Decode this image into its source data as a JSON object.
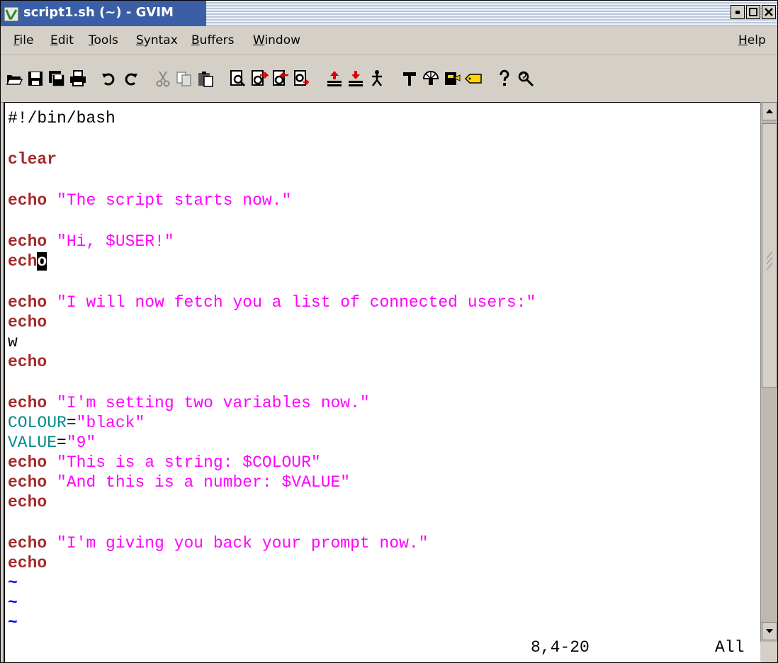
{
  "window": {
    "title": "script1.sh (~) - GVIM"
  },
  "menubar": {
    "items": [
      {
        "label": "File",
        "mnemonic": "F",
        "rest": "ile"
      },
      {
        "label": "Edit",
        "mnemonic": "E",
        "rest": "dit"
      },
      {
        "label": "Tools",
        "mnemonic": "T",
        "rest": "ools"
      },
      {
        "label": "Syntax",
        "mnemonic": "S",
        "rest": "yntax"
      },
      {
        "label": "Buffers",
        "mnemonic": "B",
        "rest": "uffers"
      },
      {
        "label": "Window",
        "mnemonic": "W",
        "rest": "indow"
      }
    ],
    "help": {
      "label": "Help",
      "mnemonic": "H",
      "rest": "elp"
    }
  },
  "toolbar": {
    "icons": [
      "open-icon",
      "save-icon",
      "save-all-icon",
      "print-icon",
      "undo-icon",
      "redo-icon",
      "cut-icon",
      "copy-icon",
      "paste-icon",
      "find-icon",
      "find-next-icon",
      "find-prev-icon",
      "replace-icon",
      "load-session-icon",
      "save-session-icon",
      "run-script-icon",
      "make-icon",
      "shell-icon",
      "ctags-icon",
      "tag-jump-icon",
      "help-icon",
      "find-help-icon"
    ]
  },
  "editor": {
    "colors": {
      "keyword": "#a52a2a",
      "string": "#ff00ff",
      "variable": "#008b8b",
      "tilde": "#0000ff"
    },
    "lines": {
      "l1": "#!/bin/bash",
      "l3_kw": "clear",
      "l5_kw": "echo",
      "l5_str": "\"The script starts now.\"",
      "l7_kw": "echo",
      "l7_str": "\"Hi, $USER!\"",
      "l8_kw_before": "ech",
      "l8_cursor": "o",
      "l10_kw": "echo",
      "l10_str": "\"I will now fetch you a list of connected users:\"",
      "l11_kw": "echo",
      "l12_plain": "w",
      "l13_kw": "echo",
      "l15_kw": "echo",
      "l15_str": "\"I'm setting two variables now.\"",
      "l16_var": "COLOUR",
      "l16_eq": "=",
      "l16_str": "\"black\"",
      "l17_var": "VALUE",
      "l17_eq": "=",
      "l17_str": "\"9\"",
      "l18_kw": "echo",
      "l18_str": "\"This is a string: $COLOUR\"",
      "l19_kw": "echo",
      "l19_str": "\"And this is a number: $VALUE\"",
      "l20_kw": "echo",
      "l22_kw": "echo",
      "l22_str": "\"I'm giving you back your prompt now.\"",
      "l23_kw": "echo",
      "tilde": "~"
    }
  },
  "statusline": {
    "position": "8,4-20",
    "scroll": "All"
  }
}
